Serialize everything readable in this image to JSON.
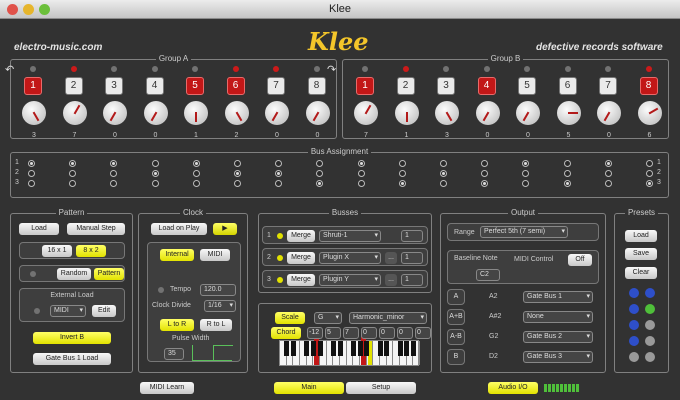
{
  "window": {
    "title": "Klee"
  },
  "header": {
    "left": "electro-music.com",
    "logo": "Klee",
    "right": "defective records software"
  },
  "groupA": {
    "label": "Group A",
    "channels": [
      {
        "num": "1",
        "active": true,
        "led": false,
        "value": "3",
        "angle": 330
      },
      {
        "num": "2",
        "active": false,
        "led": true,
        "value": "7",
        "angle": 210
      },
      {
        "num": "3",
        "active": false,
        "led": false,
        "value": "0",
        "angle": 30
      },
      {
        "num": "4",
        "active": false,
        "led": false,
        "value": "0",
        "angle": 30
      },
      {
        "num": "5",
        "active": true,
        "led": false,
        "value": "1",
        "angle": 0
      },
      {
        "num": "6",
        "active": true,
        "led": true,
        "value": "2",
        "angle": 330
      },
      {
        "num": "7",
        "active": false,
        "led": true,
        "value": "0",
        "angle": 30
      },
      {
        "num": "8",
        "active": false,
        "led": false,
        "value": "0",
        "angle": 30
      }
    ]
  },
  "groupB": {
    "label": "Group B",
    "channels": [
      {
        "num": "1",
        "active": true,
        "led": false,
        "value": "7",
        "angle": 210
      },
      {
        "num": "2",
        "active": false,
        "led": true,
        "value": "1",
        "angle": 0
      },
      {
        "num": "3",
        "active": false,
        "led": false,
        "value": "3",
        "angle": 330
      },
      {
        "num": "4",
        "active": true,
        "led": false,
        "value": "0",
        "angle": 30
      },
      {
        "num": "5",
        "active": false,
        "led": false,
        "value": "0",
        "angle": 30
      },
      {
        "num": "6",
        "active": false,
        "led": false,
        "value": "5",
        "angle": 270
      },
      {
        "num": "7",
        "active": false,
        "led": false,
        "value": "0",
        "angle": 30
      },
      {
        "num": "8",
        "active": true,
        "led": true,
        "value": "6",
        "angle": 240
      }
    ]
  },
  "bus_assignment": {
    "label": "Bus Assignment",
    "rows": [
      "1",
      "2",
      "3"
    ],
    "selected": [
      1,
      1,
      1,
      2,
      1,
      2,
      2,
      3,
      1,
      3,
      2,
      3,
      1,
      3,
      1,
      3
    ]
  },
  "pattern": {
    "label": "Pattern",
    "load": "Load",
    "manual_step": "Manual Step",
    "size16": "16 x 1",
    "size8": "8 x 2",
    "random": "Random",
    "pattern": "Pattern",
    "external_load": "External Load",
    "midi": "MIDI",
    "edit": "Edit",
    "invert": "Invert B",
    "gate_bus": "Gate Bus 1 Load"
  },
  "clock": {
    "label": "Clock",
    "load_on_play": "Load on Play",
    "play": "▶",
    "internal": "Internal",
    "midi": "MIDI",
    "tempo_label": "Tempo",
    "tempo": "120.0",
    "divide_label": "Clock Divide",
    "divide": "1/16",
    "l_to_r": "L to R",
    "r_to_l": "R to L",
    "pulse_label": "Pulse Width",
    "pulse": "35"
  },
  "busses": {
    "label": "Busses",
    "rows": [
      {
        "n": "1",
        "merge": "Merge",
        "dest": "Shruti-1",
        "ch": "1",
        "dots": false
      },
      {
        "n": "2",
        "merge": "Merge",
        "dest": "Plugin X",
        "ch": "1",
        "dots": true
      },
      {
        "n": "3",
        "merge": "Merge",
        "dest": "Plugin Y",
        "ch": "1",
        "dots": true
      }
    ]
  },
  "scale": {
    "scale_btn": "Scale",
    "root": "G",
    "mode": "Harmonic_minor",
    "chord_btn": "Chord",
    "chord": [
      "-12",
      "5",
      "7",
      "0",
      "0",
      "0",
      "0"
    ]
  },
  "output": {
    "label": "Output",
    "range_label": "Range",
    "range": "Perfect 5th (7 semi)",
    "baseline_label": "Baseline Note",
    "baseline": "C2",
    "midi_control": "MIDI Control",
    "midi_off": "Off",
    "rows": [
      {
        "bus": "A",
        "note": "A2",
        "gate": "Gate Bus 1"
      },
      {
        "bus": "A+B",
        "note": "A#2",
        "gate": "None"
      },
      {
        "bus": "A-B",
        "note": "G2",
        "gate": "Gate Bus 2"
      },
      {
        "bus": "B",
        "note": "D2",
        "gate": "Gate Bus 3"
      }
    ]
  },
  "presets": {
    "label": "Presets",
    "load": "Load",
    "save": "Save",
    "clear": "Clear",
    "dot_colors": [
      "#2e4fc9",
      "#2e4fc9",
      "#2e4fc9",
      "#4fbf3a",
      "#2e4fc9",
      "#9a9a9a",
      "#2e4fc9",
      "#9a9a9a",
      "#9a9a9a",
      "#9a9a9a"
    ]
  },
  "footer": {
    "midi_learn": "MIDI Learn",
    "main": "Main",
    "setup": "Setup",
    "audio_io": "Audio I/O"
  },
  "colors": {
    "accent": "#ffff33",
    "active": "#c21717",
    "background": "#323232"
  }
}
